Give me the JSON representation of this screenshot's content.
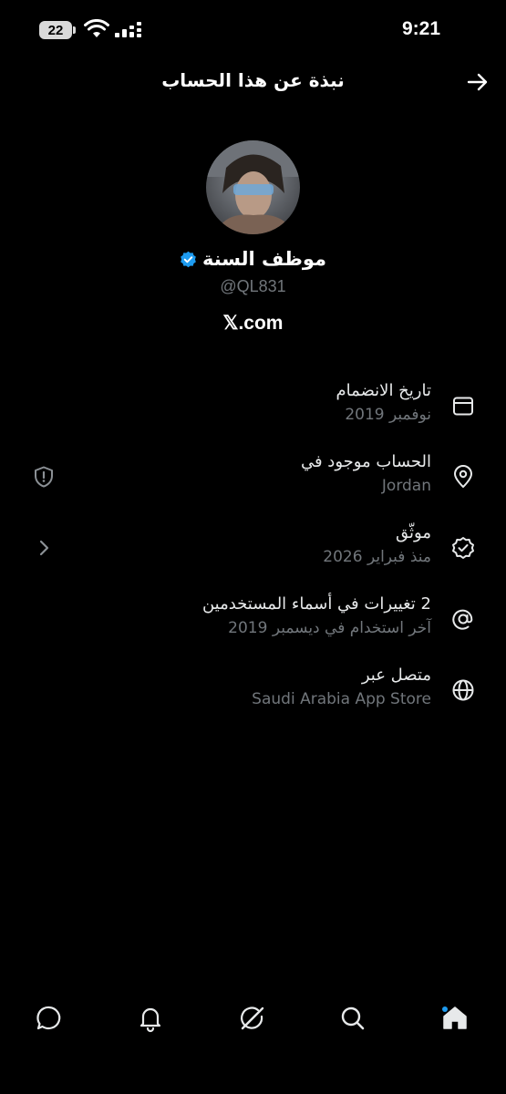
{
  "status_bar": {
    "battery": "22",
    "time": "9:21"
  },
  "header": {
    "title": "نبذة عن هذا الحساب",
    "back_icon": "arrow-right-icon"
  },
  "profile": {
    "name": "موظف السنة",
    "handle": "@QL831",
    "website": "𝕏.com",
    "verified_color": "#1d9bf0"
  },
  "info_rows": [
    {
      "icon": "calendar-icon",
      "label": "تاريخ الانضمام",
      "value": "نوفمبر 2019"
    },
    {
      "icon": "location-pin-icon",
      "label": "الحساب موجود في",
      "value": "Jordan",
      "left_icon": "shield-icon"
    },
    {
      "icon": "verified-badge-icon",
      "label": "موثّق",
      "value": "منذ فبراير 2026",
      "left_icon": "chevron-right-icon"
    },
    {
      "icon": "at-sign-icon",
      "label": "2 تغييرات في أسماء المستخدمين",
      "value": "آخر استخدام في ديسمبر 2019"
    },
    {
      "icon": "globe-icon",
      "label": "متصل عبر",
      "value": "Saudi Arabia App Store"
    }
  ],
  "bottom_nav": [
    "messages-icon",
    "notifications-icon",
    "grok-icon",
    "search-icon",
    "home-icon"
  ],
  "colors": {
    "accent": "#1d9bf0",
    "secondary_text": "#71767b",
    "background": "#000000"
  }
}
